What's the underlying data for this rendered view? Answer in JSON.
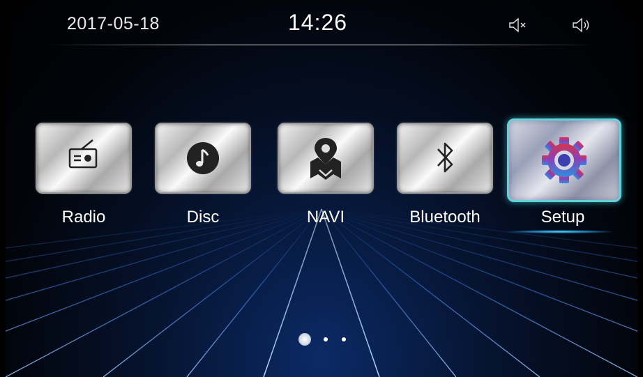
{
  "status": {
    "date": "2017-05-18",
    "time": "14:26",
    "mute_icon": "speaker-mute-icon",
    "volume_icon": "speaker-volume-icon"
  },
  "apps": [
    {
      "label": "Radio",
      "icon": "radio-icon",
      "selected": false
    },
    {
      "label": "Disc",
      "icon": "music-note-icon",
      "selected": false
    },
    {
      "label": "NAVI",
      "icon": "map-pin-icon",
      "selected": false
    },
    {
      "label": "Bluetooth",
      "icon": "bluetooth-icon",
      "selected": false
    },
    {
      "label": "Setup",
      "icon": "gear-icon",
      "selected": true
    }
  ],
  "pager": {
    "page_count": 3,
    "current_page": 1
  },
  "colors": {
    "accent": "#5fd3d8",
    "grid": "#3a78d8",
    "background": "#000000"
  }
}
